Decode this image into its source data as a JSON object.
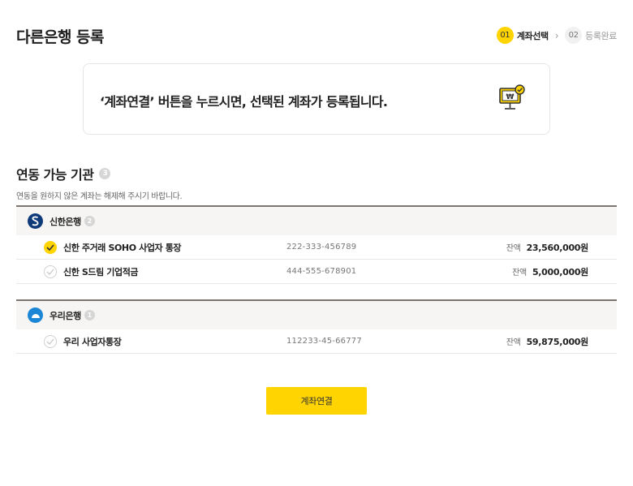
{
  "page": {
    "title": "다른은행 등록"
  },
  "steps": [
    {
      "num": "01",
      "label": "계좌선택",
      "active": true
    },
    {
      "num": "02",
      "label": "등록완료",
      "active": false
    }
  ],
  "notice": {
    "text": "‘계좌연결’ 버튼을 누르시면, 선택된 계좌가 등록됩니다.",
    "icon": "monitor-won-check-icon"
  },
  "section": {
    "title": "연동 가능 기관",
    "count": "3",
    "desc": "연동을 원하지 않은 계좌는 해제해 주시기 바랍니다."
  },
  "banks": [
    {
      "name": "신한은행",
      "count": "2",
      "logo_color": "#0f3a7a",
      "logo_icon": "shinhan-logo-icon",
      "accounts": [
        {
          "name": "신한 주거래 SOHO 사업자 통장",
          "number": "222-333-456789",
          "balance_label": "잔액",
          "balance": "23,560,000원",
          "checked": true
        },
        {
          "name": "신한 S드림 기업적금",
          "number": "444-555-678901",
          "balance_label": "잔액",
          "balance": "5,000,000원",
          "checked": false
        }
      ]
    },
    {
      "name": "우리은행",
      "count": "1",
      "logo_color": "#1b86d6",
      "logo_icon": "woori-logo-icon",
      "accounts": [
        {
          "name": "우리 사업자통장",
          "number": "112233-45-66777",
          "balance_label": "잔액",
          "balance": "59,875,000원",
          "checked": false
        }
      ]
    }
  ],
  "button": {
    "label": "계좌연결"
  },
  "colors": {
    "accent": "#ffd400",
    "divider": "#7d7670"
  }
}
